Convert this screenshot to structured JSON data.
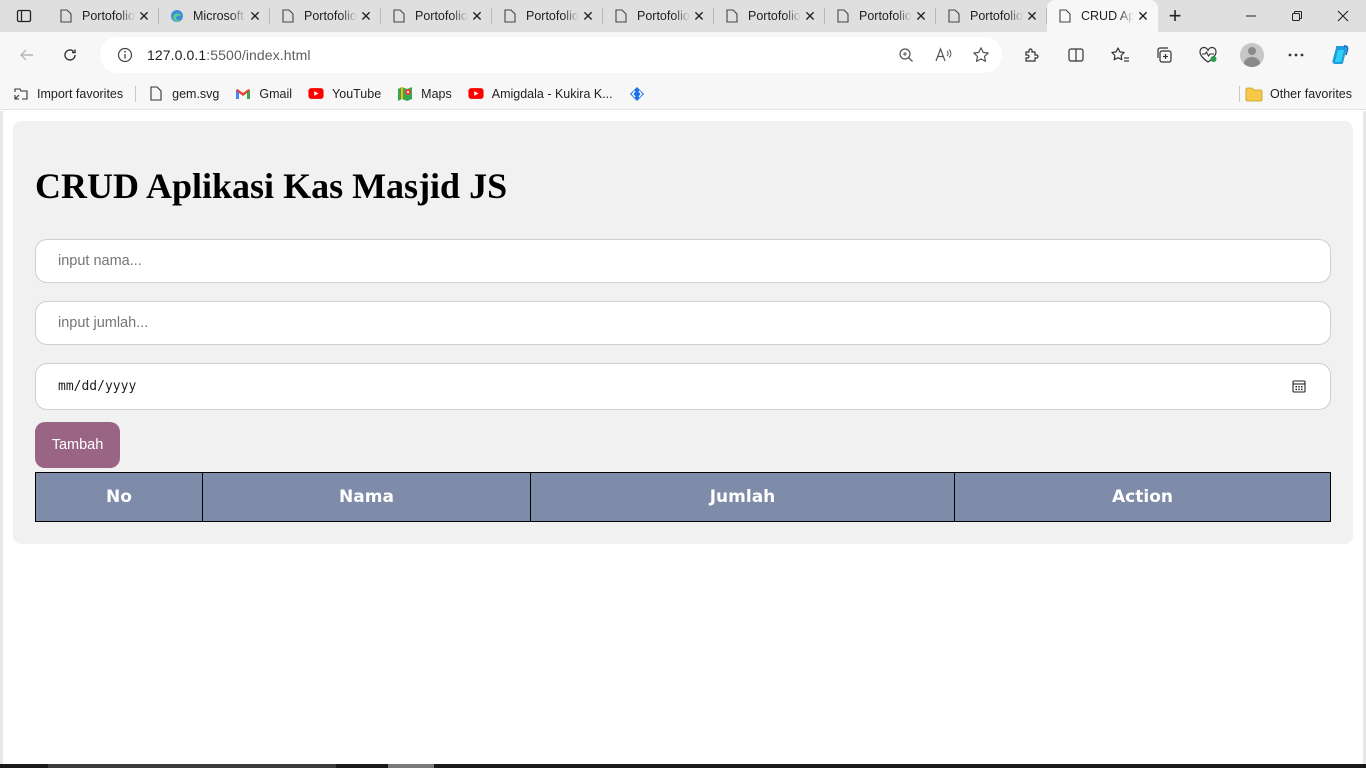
{
  "browser": {
    "tabs": [
      {
        "title": "Portofolio",
        "icon": "page-icon",
        "active": false
      },
      {
        "title": "Microsoft",
        "icon": "edge-icon",
        "active": false
      },
      {
        "title": "Portofolio",
        "icon": "page-icon",
        "active": false
      },
      {
        "title": "Portofolio",
        "icon": "page-icon",
        "active": false
      },
      {
        "title": "Portofolio",
        "icon": "page-icon",
        "active": false
      },
      {
        "title": "Portofolio",
        "icon": "page-icon",
        "active": false
      },
      {
        "title": "Portofolio",
        "icon": "page-icon",
        "active": false
      },
      {
        "title": "Portofolio",
        "icon": "page-icon",
        "active": false
      },
      {
        "title": "Portofolio",
        "icon": "page-icon",
        "active": false
      },
      {
        "title": "CRUD Aplikasi",
        "icon": "page-icon",
        "active": true
      }
    ],
    "address": {
      "host": "127.0.0.1",
      "path": ":5500/index.html"
    },
    "favorites": [
      {
        "label": "Import favorites",
        "icon": "import-icon"
      },
      {
        "label": "gem.svg",
        "icon": "file-icon"
      },
      {
        "label": "Gmail",
        "icon": "gmail-icon"
      },
      {
        "label": "YouTube",
        "icon": "youtube-icon"
      },
      {
        "label": "Maps",
        "icon": "maps-icon"
      },
      {
        "label": "Amigdala - Kukira K...",
        "icon": "youtube-icon"
      },
      {
        "label": "",
        "icon": "code-icon"
      }
    ],
    "other_favorites": "Other favorites"
  },
  "page": {
    "title": "CRUD Aplikasi Kas Masjid JS",
    "inputs": {
      "nama_placeholder": "input nama...",
      "jumlah_placeholder": "input jumlah...",
      "date_placeholder": "mm/dd/yyyy"
    },
    "add_button": "Tambah",
    "table": {
      "headers": [
        "No",
        "Nama",
        "Jumlah",
        "Action"
      ],
      "rows": []
    }
  },
  "colors": {
    "button_bg": "#9a6585",
    "table_header_bg": "#7f8ca9",
    "container_bg": "#f1f1f1"
  }
}
